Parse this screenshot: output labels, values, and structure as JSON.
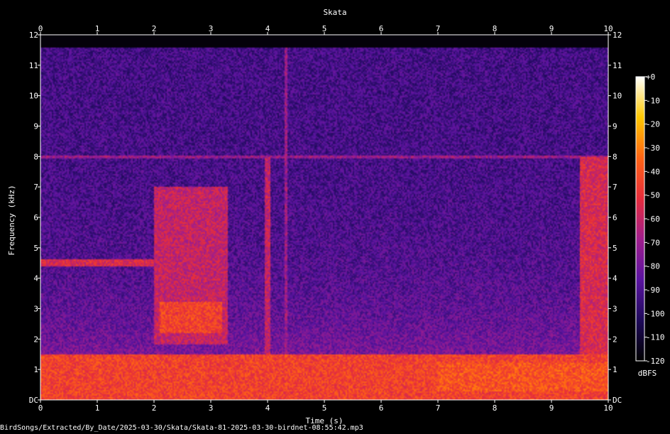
{
  "chart_data": {
    "type": "heatmap",
    "title": "Skata",
    "xlabel": "Time (s)",
    "ylabel": "Frequency (kHz)",
    "xlim": [
      0,
      10
    ],
    "ylim": [
      0,
      12
    ],
    "x_ticks": [
      "0",
      "1",
      "2",
      "3",
      "4",
      "5",
      "6",
      "7",
      "8",
      "9",
      "10"
    ],
    "y_ticks": [
      "DC",
      "1",
      "2",
      "3",
      "4",
      "5",
      "6",
      "7",
      "8",
      "9",
      "10",
      "11",
      "12"
    ],
    "colorbar": {
      "label": "dBFS",
      "range": [
        -120,
        0
      ],
      "ticks": [
        "+0",
        "-10",
        "-20",
        "-30",
        "-40",
        "-50",
        "-60",
        "-70",
        "-80",
        "-90",
        "-100",
        "-110",
        "-120"
      ],
      "colors": [
        "#000000",
        "#1e0a5a",
        "#5a14a0",
        "#a01e8c",
        "#e62d3c",
        "#ff6414",
        "#ffc800",
        "#ffffff"
      ]
    },
    "content_cutoff_khz": 11.6,
    "features": [
      {
        "type": "band",
        "t": [
          0,
          10
        ],
        "f": [
          0,
          1.5
        ],
        "level_dbfs": -45
      },
      {
        "type": "band",
        "t": [
          0,
          2
        ],
        "f": [
          4.4,
          4.6
        ],
        "level_dbfs": -55
      },
      {
        "type": "band",
        "t": [
          0,
          10
        ],
        "f": [
          7.95,
          8.05
        ],
        "level_dbfs": -70
      },
      {
        "type": "block",
        "t": [
          2.0,
          3.3
        ],
        "f": [
          1.8,
          7.0
        ],
        "level_dbfs": -60
      },
      {
        "type": "block",
        "t": [
          2.1,
          3.2
        ],
        "f": [
          2.2,
          3.2
        ],
        "level_dbfs": -45
      },
      {
        "type": "line",
        "t": [
          3.95,
          4.05
        ],
        "f": [
          0,
          8
        ],
        "level_dbfs": -60
      },
      {
        "type": "line",
        "t": [
          4.3,
          4.35
        ],
        "f": [
          0,
          11.6
        ],
        "level_dbfs": -70
      },
      {
        "type": "block",
        "t": [
          7.0,
          10.0
        ],
        "f": [
          0.3,
          1.2
        ],
        "level_dbfs": -40
      },
      {
        "type": "block",
        "t": [
          9.5,
          10.0
        ],
        "f": [
          0,
          8
        ],
        "level_dbfs": -55
      }
    ]
  },
  "footer": "BirdSongs/Extracted/By_Date/2025-03-30/Skata/Skata-81-2025-03-30-birdnet-08:55:42.mp3"
}
